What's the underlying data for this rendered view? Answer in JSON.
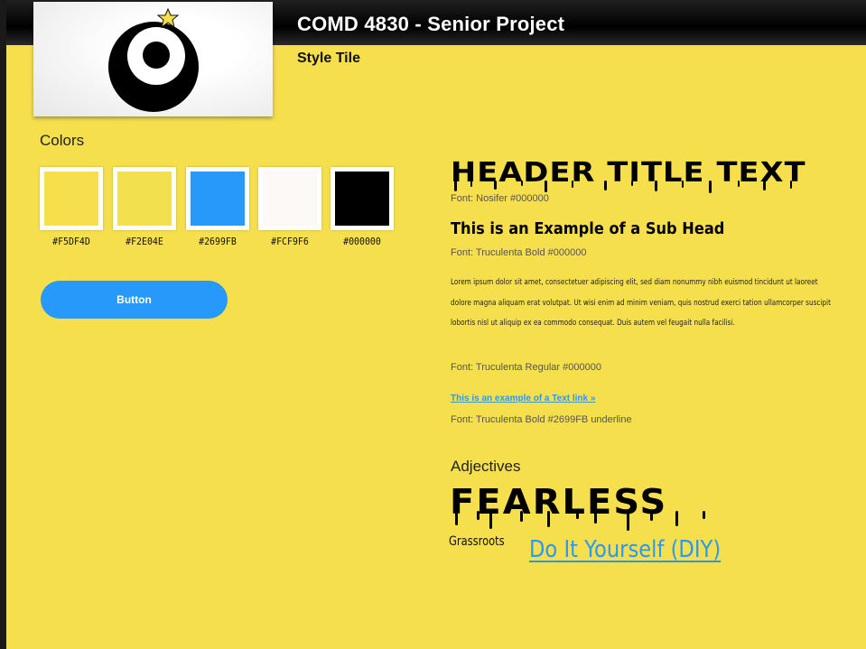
{
  "header": {
    "title": "COMD 4830 - Senior Project",
    "subtitle": "Style Tile"
  },
  "colors": {
    "label": "Colors",
    "swatches": [
      {
        "code": "#F5DF4D",
        "hex": "#F5DF4D"
      },
      {
        "code": "#F2E04E",
        "hex": "#F2E04E"
      },
      {
        "code": "#2699FB",
        "hex": "#2699FB"
      },
      {
        "code": "#FCF9F6",
        "hex": "#FCF9F6"
      },
      {
        "code": "#000000",
        "hex": "#000000"
      }
    ]
  },
  "button": {
    "label": "Button"
  },
  "typography": {
    "header_text": "HEADER TITLE TEXT",
    "header_note": "Font: Nosifer #000000",
    "subhead_text": "This is an Example of a Sub Head",
    "subhead_note": "Font: Truculenta Bold #000000",
    "body_text": "Lorem ipsum dolor sit amet, consectetuer adipiscing elit, sed diam nonummy nibh euismod tincidunt ut laoreet dolore magna aliquam erat volutpat. Ut wisi enim ad minim veniam, quis nostrud exerci tation ullamcorper suscipit lobortis nisl ut aliquip ex ea commodo consequat. Duis autem vel feugait nulla facilisi.",
    "body_note": "Font: Truculenta Regular #000000",
    "link_text": "This is an example of a Text link »",
    "link_note": "Font: Truculenta Bold #2699FB underline"
  },
  "adjectives": {
    "label": "Adjectives",
    "items": [
      "FEARLESS",
      "Grassroots",
      "Do It Yourself (DIY)"
    ]
  },
  "theme": {
    "background": "#F5DF4D",
    "accent": "#2699FB",
    "dark": "#000000"
  }
}
